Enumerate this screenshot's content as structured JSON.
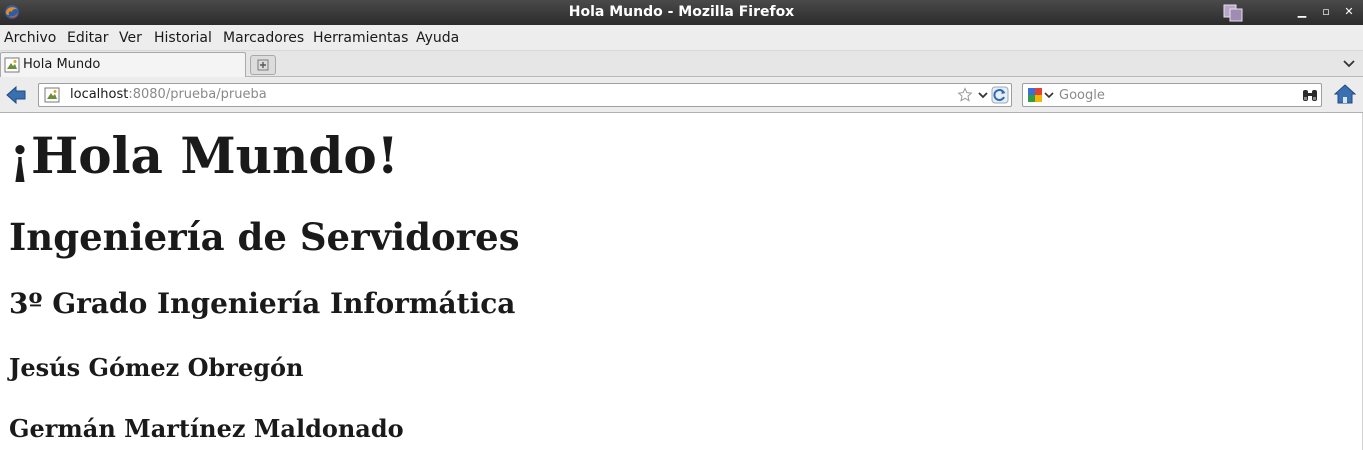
{
  "window": {
    "title": "Hola Mundo - Mozilla Firefox"
  },
  "menubar": {
    "items": [
      "Archivo",
      "Editar",
      "Ver",
      "Historial",
      "Marcadores",
      "Herramientas",
      "Ayuda"
    ]
  },
  "tabs": [
    {
      "label": "Hola Mundo"
    }
  ],
  "navbar": {
    "url_host": "localhost",
    "url_rest": ":8080/prueba/prueba",
    "search_placeholder": "Google"
  },
  "content": {
    "heading1": "¡Hola Mundo!",
    "heading2": "Ingeniería de Servidores",
    "heading3": "3º Grado Ingeniería Informática",
    "author1": "Jesús Gómez Obregón",
    "author2": "Germán Martínez Maldonado"
  }
}
